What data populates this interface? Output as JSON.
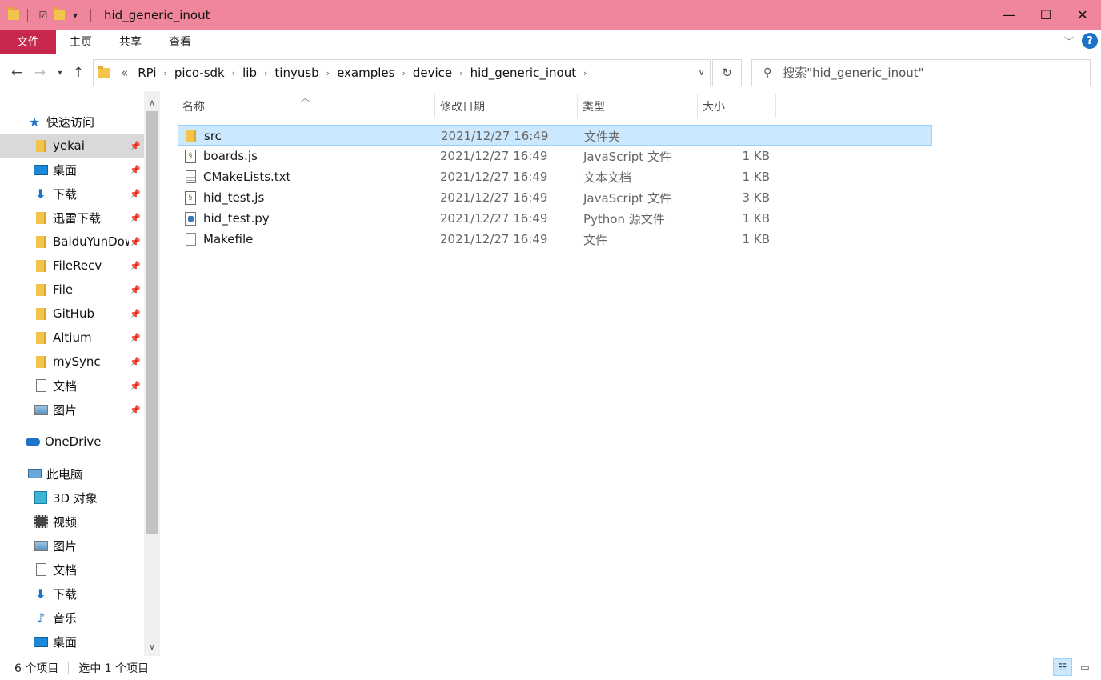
{
  "window": {
    "title": "hid_generic_inout",
    "controls": {
      "minimize": "—",
      "maximize": "☐",
      "close": "✕"
    }
  },
  "ribbon": {
    "tabs": [
      "文件",
      "主页",
      "共享",
      "查看"
    ],
    "help_label": "?"
  },
  "address": {
    "overflow": "«",
    "crumbs": [
      "RPi",
      "pico-sdk",
      "lib",
      "tinyusb",
      "examples",
      "device",
      "hid_generic_inout"
    ]
  },
  "search": {
    "placeholder": "搜索\"hid_generic_inout\""
  },
  "sidebar": {
    "quick_access": "快速访问",
    "pinned": [
      {
        "label": "yekai",
        "icon": "folder-icon"
      },
      {
        "label": "桌面",
        "icon": "desktop-icon"
      },
      {
        "label": "下载",
        "icon": "download-icon"
      },
      {
        "label": "迅雷下载",
        "icon": "folder-icon"
      },
      {
        "label": "BaiduYunDownload",
        "icon": "folder-icon"
      },
      {
        "label": "FileRecv",
        "icon": "folder-icon"
      },
      {
        "label": "File",
        "icon": "folder-icon"
      },
      {
        "label": "GitHub",
        "icon": "folder-icon"
      },
      {
        "label": "Altium",
        "icon": "folder-icon"
      },
      {
        "label": "mySync",
        "icon": "folder-icon"
      },
      {
        "label": "文档",
        "icon": "document-icon"
      },
      {
        "label": "图片",
        "icon": "picture-icon"
      }
    ],
    "onedrive": "OneDrive",
    "this_pc": "此电脑",
    "pc_items": [
      {
        "label": "3D 对象",
        "icon": "3d-objects-icon"
      },
      {
        "label": "视频",
        "icon": "video-icon"
      },
      {
        "label": "图片",
        "icon": "picture-icon"
      },
      {
        "label": "文档",
        "icon": "document-icon"
      },
      {
        "label": "下载",
        "icon": "download-icon"
      },
      {
        "label": "音乐",
        "icon": "music-icon"
      },
      {
        "label": "桌面",
        "icon": "desktop-icon"
      }
    ]
  },
  "columns": {
    "name": "名称",
    "date": "修改日期",
    "type": "类型",
    "size": "大小"
  },
  "files": [
    {
      "name": "src",
      "date": "2021/12/27 16:49",
      "type": "文件夹",
      "size": "",
      "icon": "folder-icon",
      "selected": true
    },
    {
      "name": "boards.js",
      "date": "2021/12/27 16:49",
      "type": "JavaScript 文件",
      "size": "1 KB",
      "icon": "javascript-file-icon"
    },
    {
      "name": "CMakeLists.txt",
      "date": "2021/12/27 16:49",
      "type": "文本文档",
      "size": "1 KB",
      "icon": "text-file-icon"
    },
    {
      "name": "hid_test.js",
      "date": "2021/12/27 16:49",
      "type": "JavaScript 文件",
      "size": "3 KB",
      "icon": "javascript-file-icon"
    },
    {
      "name": "hid_test.py",
      "date": "2021/12/27 16:49",
      "type": "Python 源文件",
      "size": "1 KB",
      "icon": "python-file-icon"
    },
    {
      "name": "Makefile",
      "date": "2021/12/27 16:49",
      "type": "文件",
      "size": "1 KB",
      "icon": "file-icon"
    }
  ],
  "status": {
    "item_count": "6 个项目",
    "selected_count": "选中 1 个项目"
  }
}
